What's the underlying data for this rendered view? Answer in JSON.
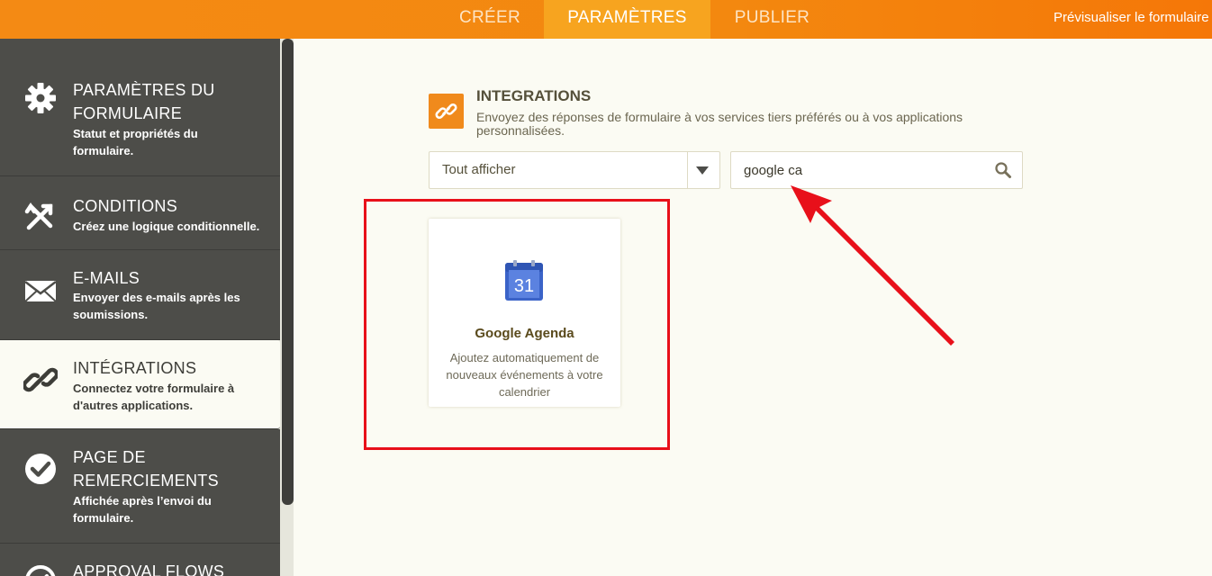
{
  "topnav": {
    "tabs": [
      {
        "label": "CRÉER",
        "active": false
      },
      {
        "label": "PARAMÈTRES",
        "active": true
      },
      {
        "label": "PUBLIER",
        "active": false
      }
    ],
    "preview_label": "Prévisualiser le formulaire"
  },
  "sidebar": {
    "items": [
      {
        "title": "PARAMÈTRES DU FORMULAIRE",
        "desc": "Statut et propriétés du formulaire.",
        "icon": "gear-icon"
      },
      {
        "title": "CONDITIONS",
        "desc": "Créez une logique conditionnelle.",
        "icon": "conditions-icon"
      },
      {
        "title": "E-MAILS",
        "desc": "Envoyer des e-mails après les soumissions.",
        "icon": "envelope-icon"
      },
      {
        "title": "INTÉGRATIONS",
        "desc": "Connectez votre formulaire à d'autres applications.",
        "icon": "link-icon",
        "active": true
      },
      {
        "title": "PAGE DE REMERCIEMENTS",
        "desc": "Affichée après l’envoi du formulaire.",
        "icon": "checkmark-icon"
      },
      {
        "title": "APPROVAL FLOWS",
        "desc": "",
        "icon": "approval-icon"
      }
    ]
  },
  "main": {
    "title": "INTEGRATIONS",
    "description": "Envoyez des réponses de formulaire à vos services tiers préférés ou à vos applications personnalisées.",
    "filter": {
      "selected": "Tout afficher"
    },
    "search": {
      "value": "google ca"
    },
    "cards": [
      {
        "icon_text": "31",
        "title": "Google Agenda",
        "description": "Ajoutez automatiquement de nouveaux événements à votre calendrier"
      }
    ]
  },
  "colors": {
    "accent": "#f48a14",
    "sidebar_bg": "#4d4d49",
    "content_bg": "#fbfbf3",
    "annotation_red": "#e8101a",
    "calendar_blue": "#4a73d8"
  }
}
